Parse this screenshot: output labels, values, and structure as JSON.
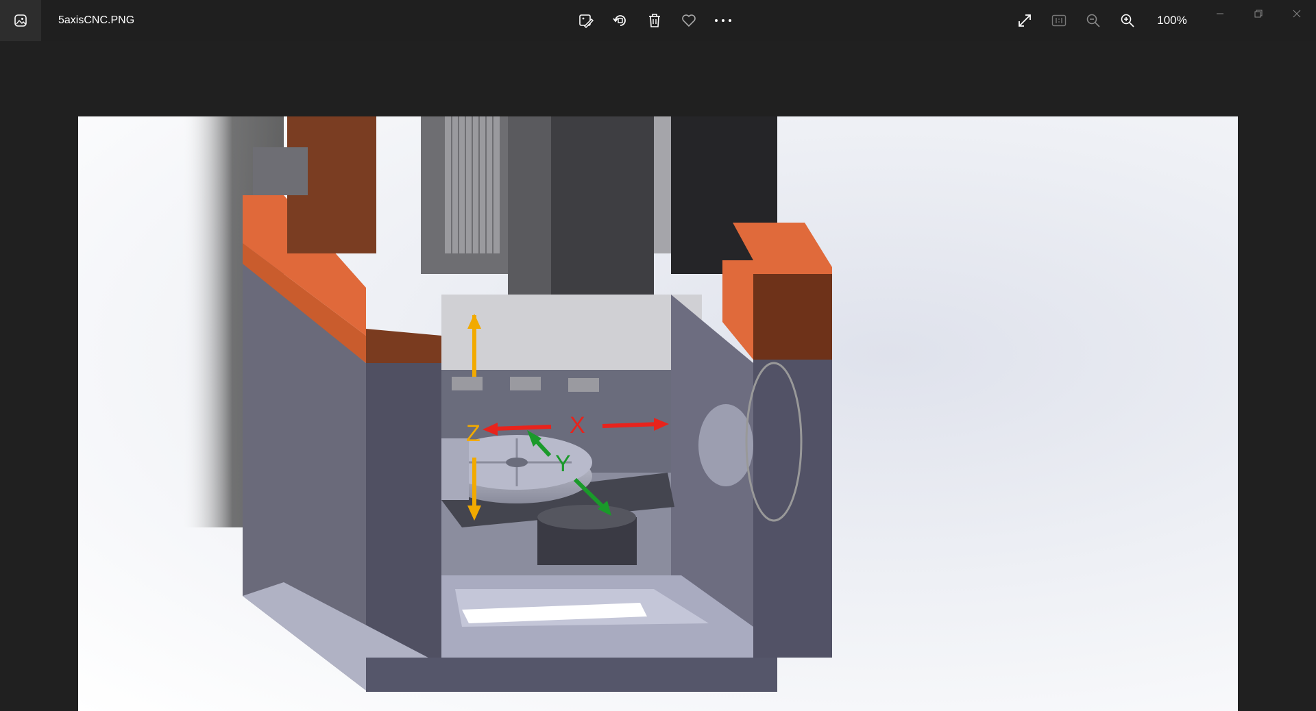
{
  "title_bar": {
    "filename": "5axisCNC.PNG",
    "app_icon": "photos-app-icon"
  },
  "toolbar": {
    "buttons": [
      {
        "name": "edit-image",
        "icon": "edit-image-icon"
      },
      {
        "name": "rotate",
        "icon": "rotate-icon"
      },
      {
        "name": "delete",
        "icon": "trash-icon"
      },
      {
        "name": "favorite",
        "icon": "heart-icon"
      },
      {
        "name": "more",
        "icon": "more-icon"
      }
    ]
  },
  "view_controls": {
    "zoom_level": "100%",
    "buttons": [
      "expand-icon",
      "actual-size-icon",
      "zoom-out-icon",
      "zoom-in-icon"
    ]
  },
  "image": {
    "axis_labels": {
      "x": "X",
      "y": "Y",
      "z": "Z"
    },
    "colors": {
      "x_axis": "#e8231c",
      "y_axis": "#1a9a2a",
      "z_axis": "#f2aa00",
      "accent_orange": "#e0693a",
      "frame_gray": "#555566"
    }
  }
}
